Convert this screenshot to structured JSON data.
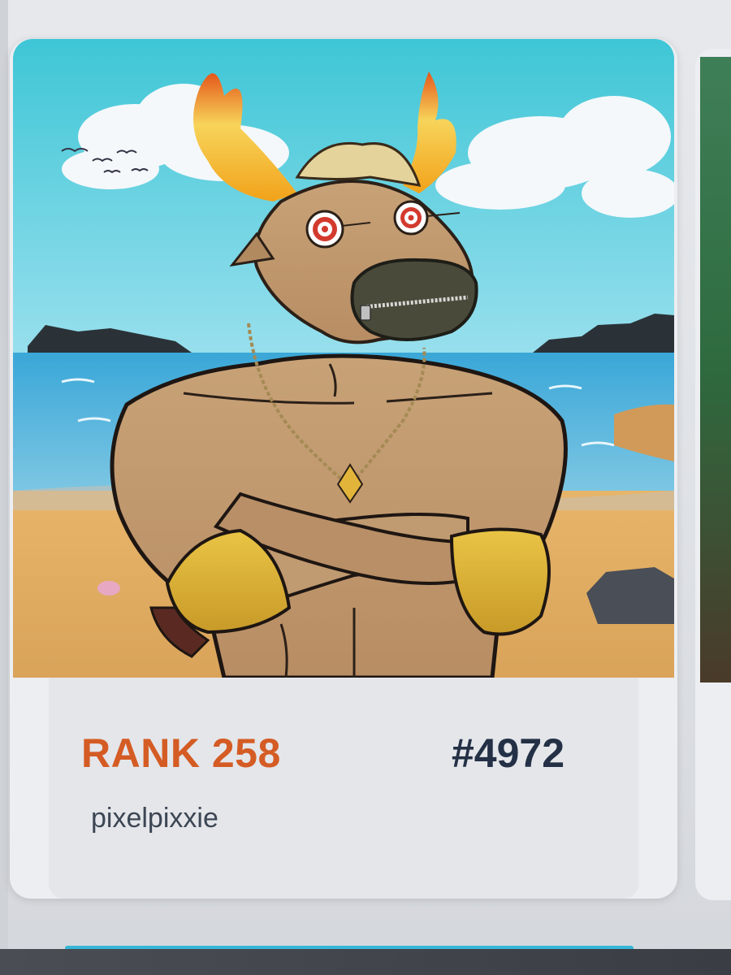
{
  "card": {
    "rank_label": "RANK 258",
    "token_id": "#4972",
    "owner": "pixelpixxie"
  },
  "artwork": {
    "alt": "Cartoon bull character with flaming horns, target eyes and zipper mouth on a beach"
  },
  "colors": {
    "rank": "#d45c24",
    "token_id": "#233045",
    "owner": "#3c4654",
    "card_bg": "#eceef1",
    "accent_bar": "#36b6d9"
  }
}
